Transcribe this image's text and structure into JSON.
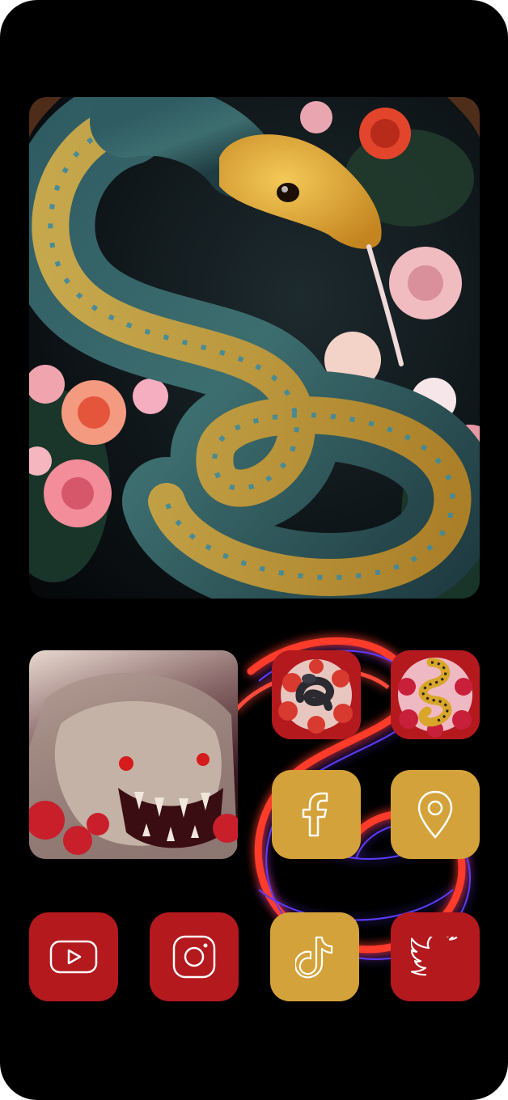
{
  "screen": {
    "background": "#000000"
  },
  "widgets": {
    "hero_image": {
      "subject": "golden-blue-snake-with-flowers"
    },
    "dragon_image": {
      "subject": "stone-dragon-with-roses"
    },
    "art_icon_1": {
      "subject": "black-snake-with-red-roses"
    },
    "art_icon_2": {
      "subject": "golden-snake-with-roses"
    }
  },
  "apps": [
    {
      "id": "facebook",
      "icon": "facebook-icon",
      "color": "#d4a23a"
    },
    {
      "id": "maps",
      "icon": "location-pin-icon",
      "color": "#d4a23a"
    },
    {
      "id": "youtube",
      "icon": "youtube-icon",
      "color": "#b4191e"
    },
    {
      "id": "instagram",
      "icon": "instagram-icon",
      "color": "#b4191e"
    },
    {
      "id": "tiktok",
      "icon": "tiktok-icon",
      "color": "#d4a23a"
    },
    {
      "id": "twitter",
      "icon": "twitter-icon",
      "color": "#b4191e"
    }
  ],
  "colors": {
    "accent_red": "#b4191e",
    "accent_gold": "#d4a23a",
    "neon_red": "#ff3a2a",
    "neon_blue": "#5a3cff"
  }
}
